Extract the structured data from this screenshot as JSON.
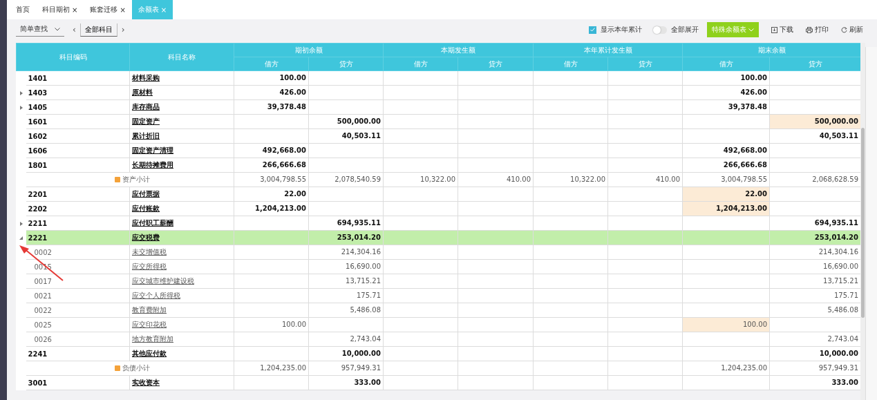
{
  "tabs": [
    {
      "label": "首页",
      "closable": false,
      "selected": false
    },
    {
      "label": "科目期初",
      "closable": true,
      "selected": false
    },
    {
      "label": "账套迁移",
      "closable": true,
      "selected": false
    },
    {
      "label": "余额表",
      "closable": true,
      "selected": true
    }
  ],
  "tab_close": "×",
  "toolbar": {
    "search_mode": "简单查找",
    "prev": "‹",
    "subject_filter": "全部科目",
    "next": "›",
    "show_year_total": {
      "label": "显示本年累计",
      "checked": true
    },
    "expand_all": {
      "label": "全部展开",
      "on": false
    },
    "special_button": "特殊余额表",
    "actions": [
      {
        "kind": "download",
        "label": "下载"
      },
      {
        "kind": "print",
        "label": "打印"
      },
      {
        "kind": "refresh",
        "label": "刷新"
      }
    ]
  },
  "table": {
    "columns": [
      "科目编码",
      "科目名称"
    ],
    "groups": [
      {
        "label": "期初余额",
        "sub": [
          "借方",
          "贷方"
        ]
      },
      {
        "label": "本期发生额",
        "sub": [
          "借方",
          "贷方"
        ]
      },
      {
        "label": "本年累计发生额",
        "sub": [
          "借方",
          "贷方"
        ]
      },
      {
        "label": "期末余额",
        "sub": [
          "借方",
          "贷方"
        ]
      }
    ],
    "rows": [
      {
        "kind": "account",
        "code": "1401",
        "name": "材料采购",
        "expandable": false,
        "selected": false,
        "cells": [
          {
            "text": "100.00",
            "flagged": false
          },
          {
            "flagged": false
          },
          {
            "flagged": false
          },
          {
            "flagged": false
          },
          {
            "flagged": false
          },
          {
            "flagged": false
          },
          {
            "text": "100.00",
            "flagged": false
          },
          {
            "flagged": false
          }
        ]
      },
      {
        "kind": "account",
        "code": "1403",
        "name": "原材料",
        "expandable": true,
        "expanded": false,
        "selected": false,
        "cells": [
          {
            "text": "426.00",
            "flagged": false
          },
          {
            "flagged": false
          },
          {
            "flagged": false
          },
          {
            "flagged": false
          },
          {
            "flagged": false
          },
          {
            "flagged": false
          },
          {
            "text": "426.00",
            "flagged": false
          },
          {
            "flagged": false
          }
        ]
      },
      {
        "kind": "account",
        "code": "1405",
        "name": "库存商品",
        "expandable": true,
        "expanded": false,
        "selected": false,
        "cells": [
          {
            "text": "39,378.48",
            "flagged": false
          },
          {
            "flagged": false
          },
          {
            "flagged": false
          },
          {
            "flagged": false
          },
          {
            "flagged": false
          },
          {
            "flagged": false
          },
          {
            "text": "39,378.48",
            "flagged": false
          },
          {
            "flagged": false
          }
        ]
      },
      {
        "kind": "account",
        "code": "1601",
        "name": "固定资产",
        "expandable": false,
        "selected": false,
        "cells": [
          {
            "flagged": false
          },
          {
            "text": "500,000.00",
            "flagged": false
          },
          {
            "flagged": false
          },
          {
            "flagged": false
          },
          {
            "flagged": false
          },
          {
            "flagged": false
          },
          {
            "flagged": false
          },
          {
            "text": "500,000.00",
            "flagged": true
          }
        ]
      },
      {
        "kind": "account",
        "code": "1602",
        "name": "累计折旧",
        "expandable": false,
        "selected": false,
        "cells": [
          {
            "flagged": false
          },
          {
            "text": "40,503.11",
            "flagged": false
          },
          {
            "flagged": false
          },
          {
            "flagged": false
          },
          {
            "flagged": false
          },
          {
            "flagged": false
          },
          {
            "flagged": false
          },
          {
            "text": "40,503.11",
            "flagged": false
          }
        ]
      },
      {
        "kind": "account",
        "code": "1606",
        "name": "固定资产清理",
        "expandable": false,
        "selected": false,
        "cells": [
          {
            "text": "492,668.00",
            "flagged": false
          },
          {
            "flagged": false
          },
          {
            "flagged": false
          },
          {
            "flagged": false
          },
          {
            "flagged": false
          },
          {
            "flagged": false
          },
          {
            "text": "492,668.00",
            "flagged": false
          },
          {
            "flagged": false
          }
        ]
      },
      {
        "kind": "account",
        "code": "1801",
        "name": "长期待摊费用",
        "expandable": false,
        "selected": false,
        "cells": [
          {
            "text": "266,666.68",
            "flagged": false
          },
          {
            "flagged": false
          },
          {
            "flagged": false
          },
          {
            "flagged": false
          },
          {
            "flagged": false
          },
          {
            "flagged": false
          },
          {
            "text": "266,666.68",
            "flagged": false
          },
          {
            "flagged": false
          }
        ]
      },
      {
        "kind": "subtotal",
        "name": "资产小计",
        "selected": false,
        "cells": [
          {
            "text": "3,004,798.55",
            "flagged": false
          },
          {
            "text": "2,078,540.59",
            "flagged": false
          },
          {
            "text": "10,322.00",
            "flagged": false
          },
          {
            "text": "410.00",
            "flagged": false
          },
          {
            "text": "10,322.00",
            "flagged": false
          },
          {
            "text": "410.00",
            "flagged": false
          },
          {
            "text": "3,004,798.55",
            "flagged": false
          },
          {
            "text": "2,068,628.59",
            "flagged": false
          }
        ]
      },
      {
        "kind": "account",
        "code": "2201",
        "name": "应付票据",
        "expandable": false,
        "selected": false,
        "cells": [
          {
            "text": "22.00",
            "flagged": false
          },
          {
            "flagged": false
          },
          {
            "flagged": false
          },
          {
            "flagged": false
          },
          {
            "flagged": false
          },
          {
            "flagged": false
          },
          {
            "text": "22.00",
            "flagged": true
          },
          {
            "flagged": false
          }
        ]
      },
      {
        "kind": "account",
        "code": "2202",
        "name": "应付账款",
        "expandable": false,
        "selected": false,
        "cells": [
          {
            "text": "1,204,213.00",
            "flagged": false
          },
          {
            "flagged": false
          },
          {
            "flagged": false
          },
          {
            "flagged": false
          },
          {
            "flagged": false
          },
          {
            "flagged": false
          },
          {
            "text": "1,204,213.00",
            "flagged": true
          },
          {
            "flagged": false
          }
        ]
      },
      {
        "kind": "account",
        "code": "2211",
        "name": "应付职工薪酬",
        "expandable": true,
        "expanded": false,
        "selected": false,
        "cells": [
          {
            "flagged": false
          },
          {
            "text": "694,935.11",
            "flagged": false
          },
          {
            "flagged": false
          },
          {
            "flagged": false
          },
          {
            "flagged": false
          },
          {
            "flagged": false
          },
          {
            "flagged": false
          },
          {
            "text": "694,935.11",
            "flagged": false
          }
        ]
      },
      {
        "kind": "account",
        "code": "2221",
        "name": "应交税费",
        "expandable": true,
        "expanded": true,
        "selected": true,
        "cells": [
          {
            "flagged": false
          },
          {
            "text": "253,014.20",
            "flagged": false
          },
          {
            "flagged": false
          },
          {
            "flagged": false
          },
          {
            "flagged": false
          },
          {
            "flagged": false
          },
          {
            "flagged": false
          },
          {
            "text": "253,014.20",
            "flagged": false
          }
        ],
        "children": [
          {
            "kind": "detail",
            "code": "0002",
            "name": "未交增值税",
            "selected": false,
            "cells": [
              {
                "flagged": false
              },
              {
                "text": "214,304.16",
                "flagged": false
              },
              {
                "flagged": false
              },
              {
                "flagged": false
              },
              {
                "flagged": false
              },
              {
                "flagged": false
              },
              {
                "flagged": false
              },
              {
                "text": "214,304.16",
                "flagged": false
              }
            ]
          },
          {
            "kind": "detail",
            "code": "0015",
            "name": "应交所得税",
            "selected": false,
            "cells": [
              {
                "flagged": false
              },
              {
                "text": "16,690.00",
                "flagged": false
              },
              {
                "flagged": false
              },
              {
                "flagged": false
              },
              {
                "flagged": false
              },
              {
                "flagged": false
              },
              {
                "flagged": false
              },
              {
                "text": "16,690.00",
                "flagged": false
              }
            ]
          },
          {
            "kind": "detail",
            "code": "0017",
            "name": "应交城市维护建设税",
            "selected": false,
            "cells": [
              {
                "flagged": false
              },
              {
                "text": "13,715.21",
                "flagged": false
              },
              {
                "flagged": false
              },
              {
                "flagged": false
              },
              {
                "flagged": false
              },
              {
                "flagged": false
              },
              {
                "flagged": false
              },
              {
                "text": "13,715.21",
                "flagged": false
              }
            ]
          },
          {
            "kind": "detail",
            "code": "0021",
            "name": "应交个人所得税",
            "selected": false,
            "cells": [
              {
                "flagged": false
              },
              {
                "text": "175.71",
                "flagged": false
              },
              {
                "flagged": false
              },
              {
                "flagged": false
              },
              {
                "flagged": false
              },
              {
                "flagged": false
              },
              {
                "flagged": false
              },
              {
                "text": "175.71",
                "flagged": false
              }
            ]
          },
          {
            "kind": "detail",
            "code": "0022",
            "name": "教育费附加",
            "selected": false,
            "cells": [
              {
                "flagged": false
              },
              {
                "text": "5,486.08",
                "flagged": false
              },
              {
                "flagged": false
              },
              {
                "flagged": false
              },
              {
                "flagged": false
              },
              {
                "flagged": false
              },
              {
                "flagged": false
              },
              {
                "text": "5,486.08",
                "flagged": false
              }
            ]
          },
          {
            "kind": "detail",
            "code": "0025",
            "name": "应交印花税",
            "selected": false,
            "cells": [
              {
                "text": "100.00",
                "flagged": false
              },
              {
                "flagged": false
              },
              {
                "flagged": false
              },
              {
                "flagged": false
              },
              {
                "flagged": false
              },
              {
                "flagged": false
              },
              {
                "text": "100.00",
                "flagged": true
              },
              {
                "flagged": false
              }
            ]
          },
          {
            "kind": "detail",
            "code": "0026",
            "name": "地方教育附加",
            "selected": false,
            "cells": [
              {
                "flagged": false
              },
              {
                "text": "2,743.04",
                "flagged": false
              },
              {
                "flagged": false
              },
              {
                "flagged": false
              },
              {
                "flagged": false
              },
              {
                "flagged": false
              },
              {
                "flagged": false
              },
              {
                "text": "2,743.04",
                "flagged": false
              }
            ]
          }
        ]
      },
      {
        "kind": "account",
        "code": "2241",
        "name": "其他应付款",
        "expandable": false,
        "selected": false,
        "cells": [
          {
            "flagged": false
          },
          {
            "text": "10,000.00",
            "flagged": false
          },
          {
            "flagged": false
          },
          {
            "flagged": false
          },
          {
            "flagged": false
          },
          {
            "flagged": false
          },
          {
            "flagged": false
          },
          {
            "text": "10,000.00",
            "flagged": false
          }
        ]
      },
      {
        "kind": "subtotal",
        "name": "负债小计",
        "selected": false,
        "cells": [
          {
            "text": "1,204,235.00",
            "flagged": false
          },
          {
            "text": "957,949.31",
            "flagged": false
          },
          {
            "flagged": false
          },
          {
            "flagged": false
          },
          {
            "flagged": false
          },
          {
            "flagged": false
          },
          {
            "text": "1,204,235.00",
            "flagged": false
          },
          {
            "text": "957,949.31",
            "flagged": false
          }
        ]
      },
      {
        "kind": "account",
        "code": "3001",
        "name": "实收资本",
        "expandable": false,
        "selected": false,
        "cells": [
          {
            "flagged": false
          },
          {
            "text": "333.00",
            "flagged": false
          },
          {
            "flagged": false
          },
          {
            "flagged": false
          },
          {
            "flagged": false
          },
          {
            "flagged": false
          },
          {
            "flagged": false
          },
          {
            "text": "333.00",
            "flagged": false
          }
        ]
      }
    ]
  }
}
